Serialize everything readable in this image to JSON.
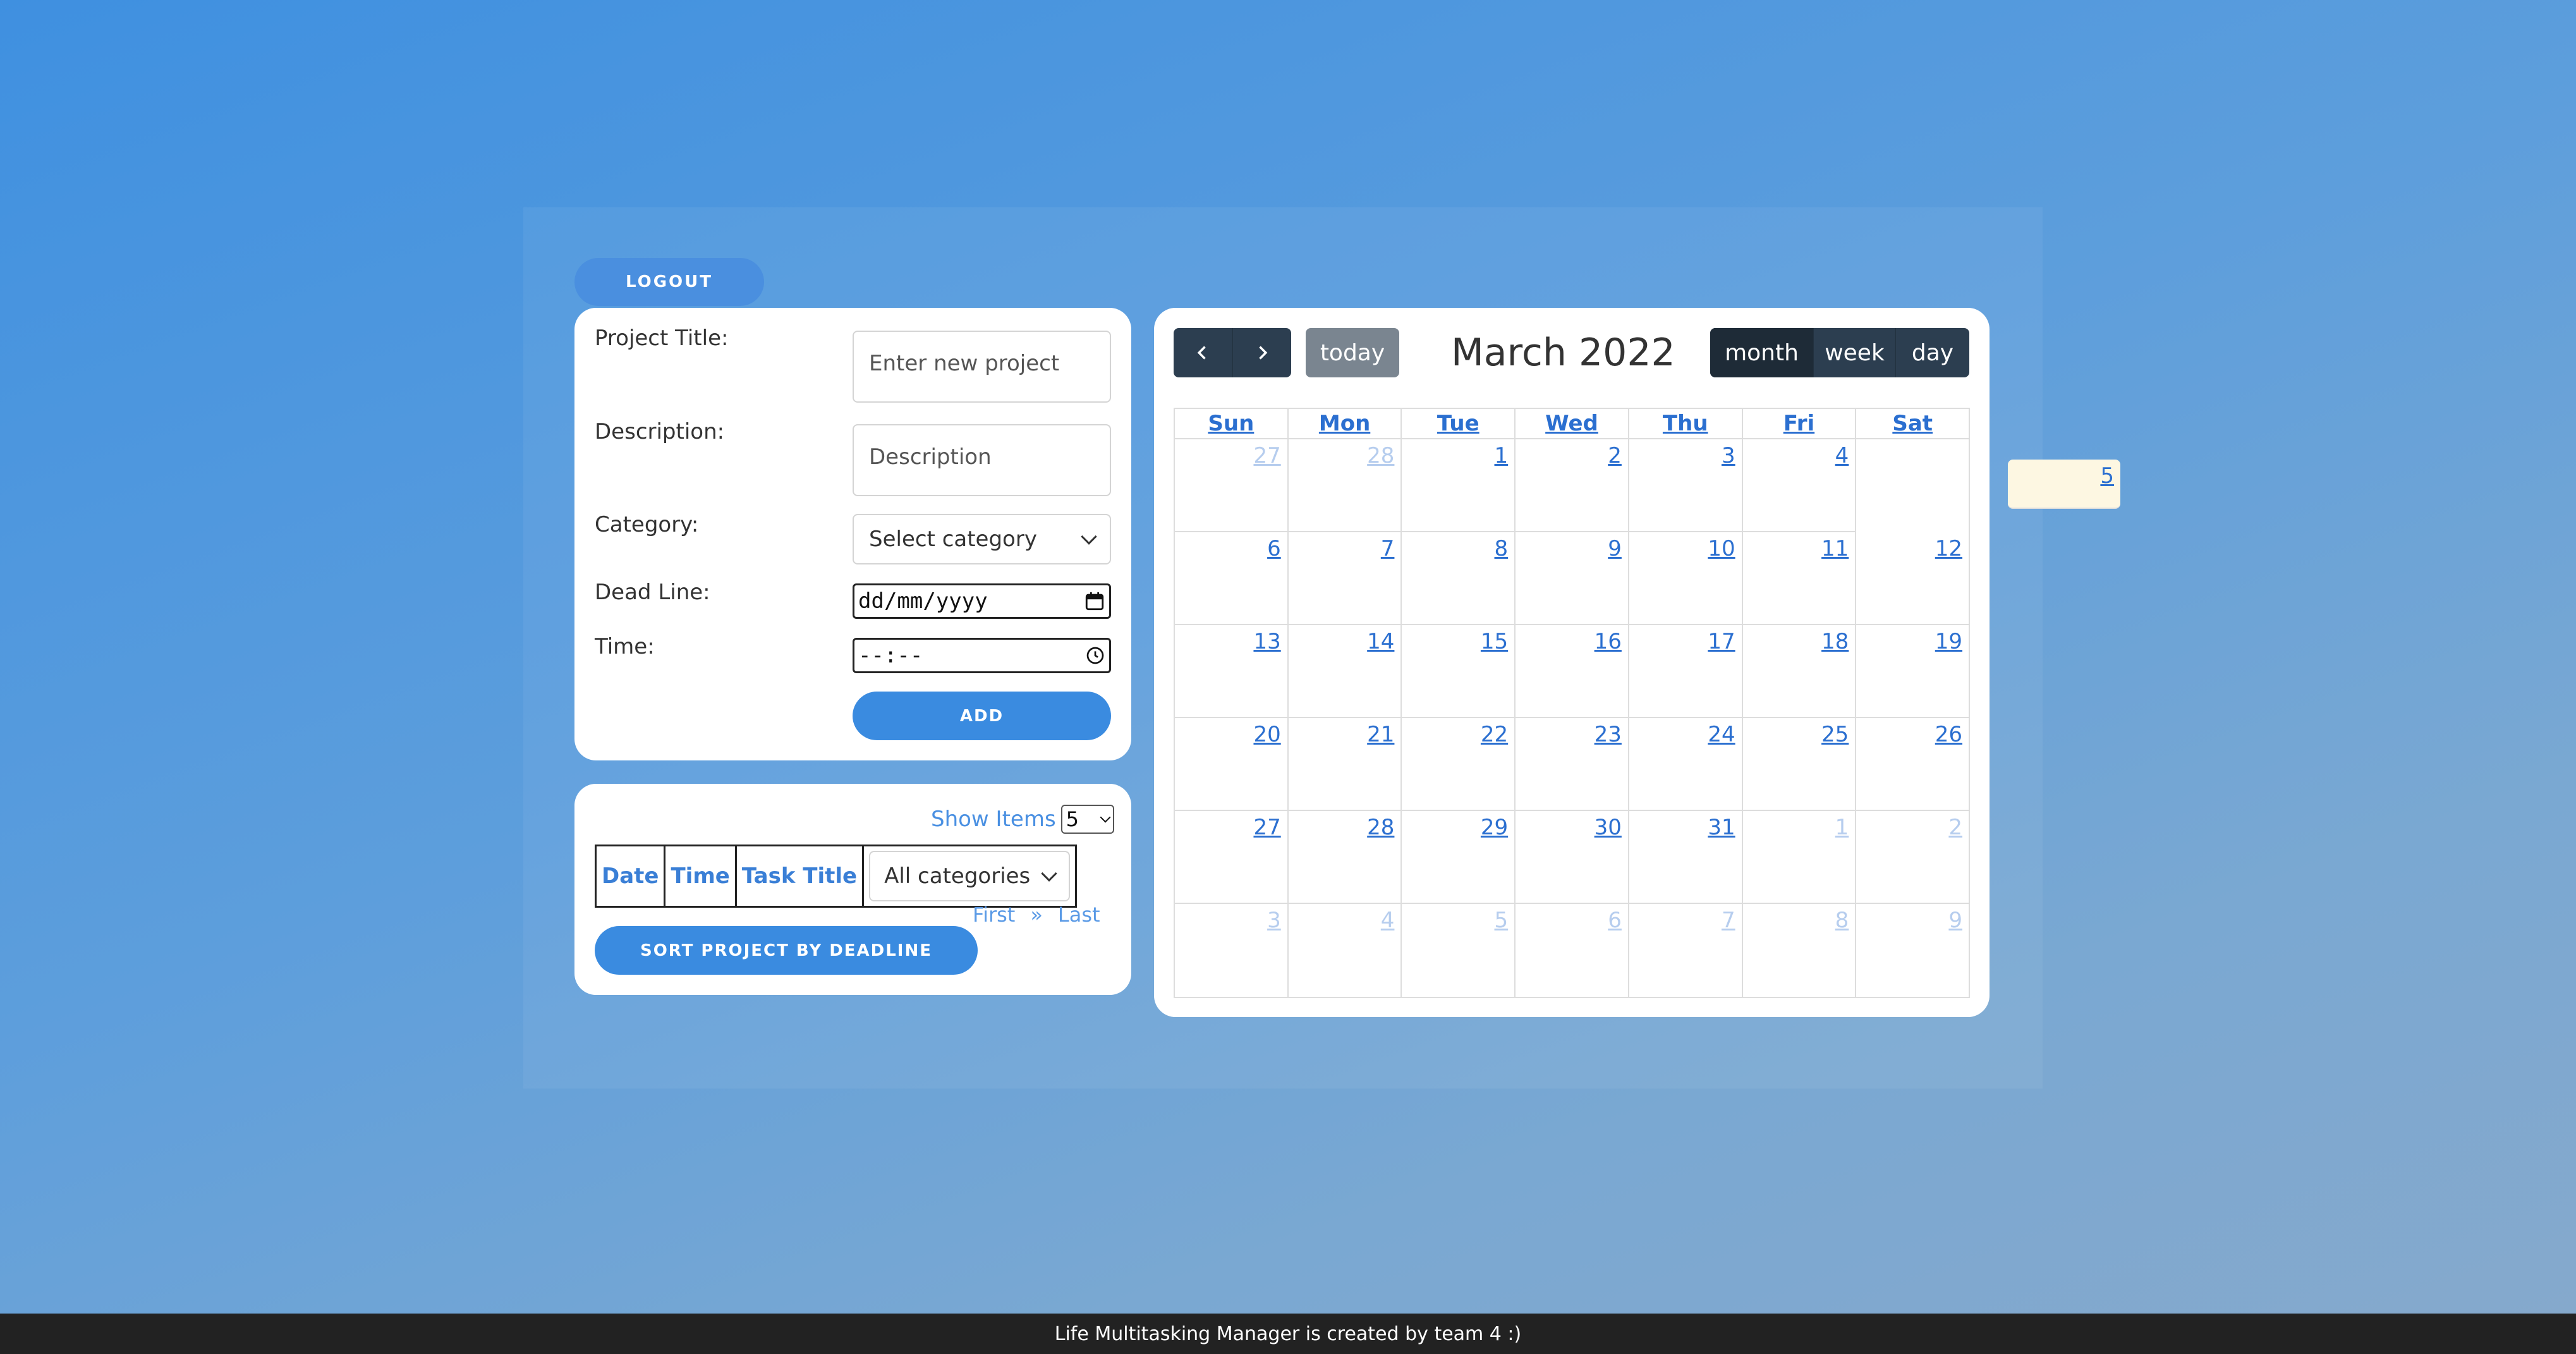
{
  "header": {
    "logout_label": "LOGOUT"
  },
  "form": {
    "project_title_label": "Project Title:",
    "project_title_placeholder": "Enter new project",
    "description_label": "Description:",
    "description_placeholder": "Description",
    "category_label": "Category:",
    "category_value": "Select category",
    "deadline_label": "Dead Line:",
    "deadline_value": "dd/mm/yyyy",
    "time_label": "Time:",
    "time_value": "--:--",
    "add_label": "ADD"
  },
  "list": {
    "show_items_label": "Show Items",
    "show_items_value": "5",
    "columns": [
      "Date",
      "Time",
      "Task Title"
    ],
    "category_filter": "All categories",
    "pager": {
      "first": "First",
      "next": "»",
      "last": "Last"
    },
    "sort_label": "SORT PROJECT BY DEADLINE"
  },
  "calendar": {
    "title": "March 2022",
    "today_label": "today",
    "prev_icon": "chevron-left-icon",
    "next_icon": "chevron-right-icon",
    "views": [
      "month",
      "week",
      "day"
    ],
    "active_view": "month",
    "weekdays": [
      "Sun",
      "Mon",
      "Tue",
      "Wed",
      "Thu",
      "Fri",
      "Sat"
    ],
    "weeks": [
      [
        {
          "d": "27",
          "o": true
        },
        {
          "d": "28",
          "o": true
        },
        {
          "d": "1"
        },
        {
          "d": "2"
        },
        {
          "d": "3"
        },
        {
          "d": "4"
        },
        {
          "d": "5",
          "t": true
        }
      ],
      [
        {
          "d": "6"
        },
        {
          "d": "7"
        },
        {
          "d": "8"
        },
        {
          "d": "9"
        },
        {
          "d": "10"
        },
        {
          "d": "11"
        },
        {
          "d": "12"
        }
      ],
      [
        {
          "d": "13"
        },
        {
          "d": "14"
        },
        {
          "d": "15"
        },
        {
          "d": "16"
        },
        {
          "d": "17"
        },
        {
          "d": "18"
        },
        {
          "d": "19"
        }
      ],
      [
        {
          "d": "20"
        },
        {
          "d": "21"
        },
        {
          "d": "22"
        },
        {
          "d": "23"
        },
        {
          "d": "24"
        },
        {
          "d": "25"
        },
        {
          "d": "26"
        }
      ],
      [
        {
          "d": "27"
        },
        {
          "d": "28"
        },
        {
          "d": "29"
        },
        {
          "d": "30"
        },
        {
          "d": "31"
        },
        {
          "d": "1",
          "o": true
        },
        {
          "d": "2",
          "o": true
        }
      ],
      [
        {
          "d": "3",
          "o": true
        },
        {
          "d": "4",
          "o": true
        },
        {
          "d": "5",
          "o": true
        },
        {
          "d": "6",
          "o": true
        },
        {
          "d": "7",
          "o": true
        },
        {
          "d": "8",
          "o": true
        },
        {
          "d": "9",
          "o": true
        }
      ]
    ]
  },
  "footer": {
    "text": "Life Multitasking Manager is created by team 4 :)"
  },
  "colors": {
    "accent": "#3a8be0",
    "dark": "#2c3e50",
    "today_bg": "#fdf7e2",
    "link": "#2b6fd0"
  }
}
